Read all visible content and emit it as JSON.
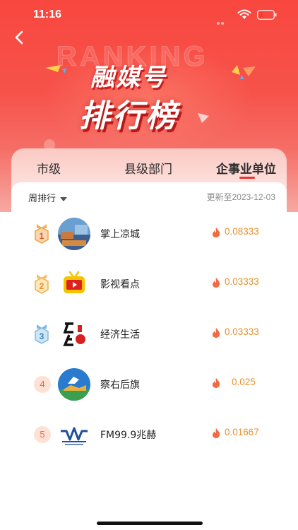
{
  "status_bar": {
    "time": "11:16"
  },
  "banner": {
    "background_word": "RANKING",
    "title_line1": "融媒号",
    "title_line2": "排行榜"
  },
  "tabs": [
    {
      "label": "市级",
      "active": false
    },
    {
      "label": "县级部门",
      "active": false
    },
    {
      "label": "企事业单位",
      "active": true
    }
  ],
  "ranking": {
    "period_label": "周排行",
    "updated_text": "更新至2023-12-03",
    "items": [
      {
        "rank": "1",
        "name": "掌上凉城",
        "score": "0.08333"
      },
      {
        "rank": "2",
        "name": "影视看点",
        "score": "0.03333"
      },
      {
        "rank": "3",
        "name": "经济生活",
        "score": "0.03333"
      },
      {
        "rank": "4",
        "name": "察右后旗",
        "score": "0.025"
      },
      {
        "rank": "5",
        "name": "FM99.9兆赫",
        "score": "0.01667"
      }
    ]
  },
  "colors": {
    "brand_red": "#f8473f",
    "score_orange": "#e8902a",
    "medal_gold": "#f0a040",
    "medal_silver": "#8ab8d8"
  },
  "icons": {
    "back": "chevron-left-icon",
    "flame": "flame-icon",
    "caret": "caret-down-icon"
  }
}
